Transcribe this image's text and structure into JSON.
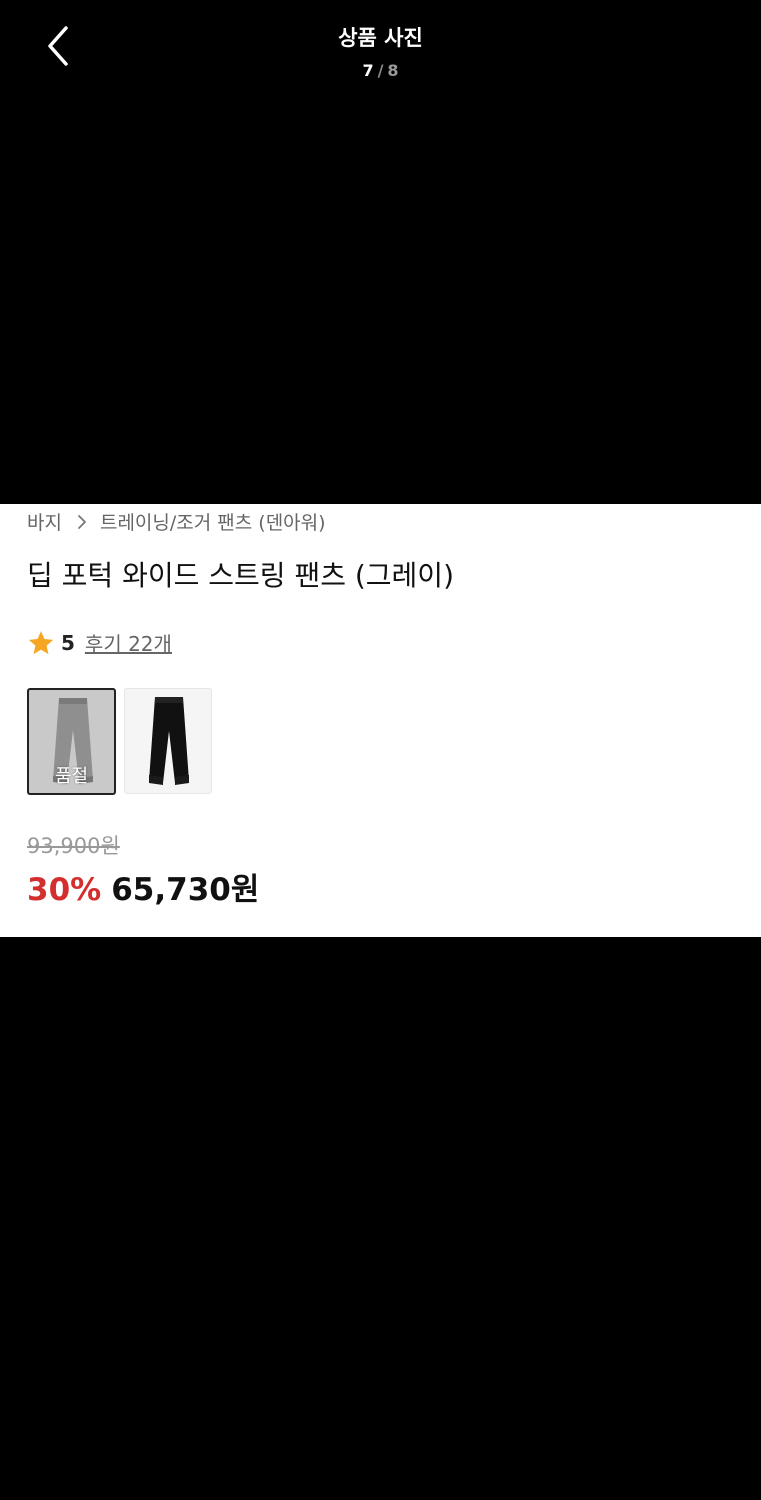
{
  "header": {
    "title": "상품 사진",
    "counter_current": "7",
    "counter_separator": "/",
    "counter_total": "8"
  },
  "breadcrumb": {
    "items": [
      "바지",
      "트레이닝/조거 팬츠 (덴아워)"
    ]
  },
  "product": {
    "name": "딥 포턱 와이드 스트링 팬츠 (그레이)",
    "rating": "5",
    "reviews_label": "후기 22개",
    "options": [
      {
        "color": "gray",
        "selected": true,
        "soldout_label": "품절"
      },
      {
        "color": "black",
        "selected": false
      }
    ],
    "original_price": "93,900원",
    "discount": "30%",
    "sale_price": "65,730원"
  },
  "colors": {
    "discount": "#d32f2f",
    "star": "#f5a623",
    "background": "#000000"
  },
  "icons": {
    "back": "chevron-left-icon",
    "breadcrumb_separator": "chevron-right-icon",
    "rating": "star-icon"
  }
}
